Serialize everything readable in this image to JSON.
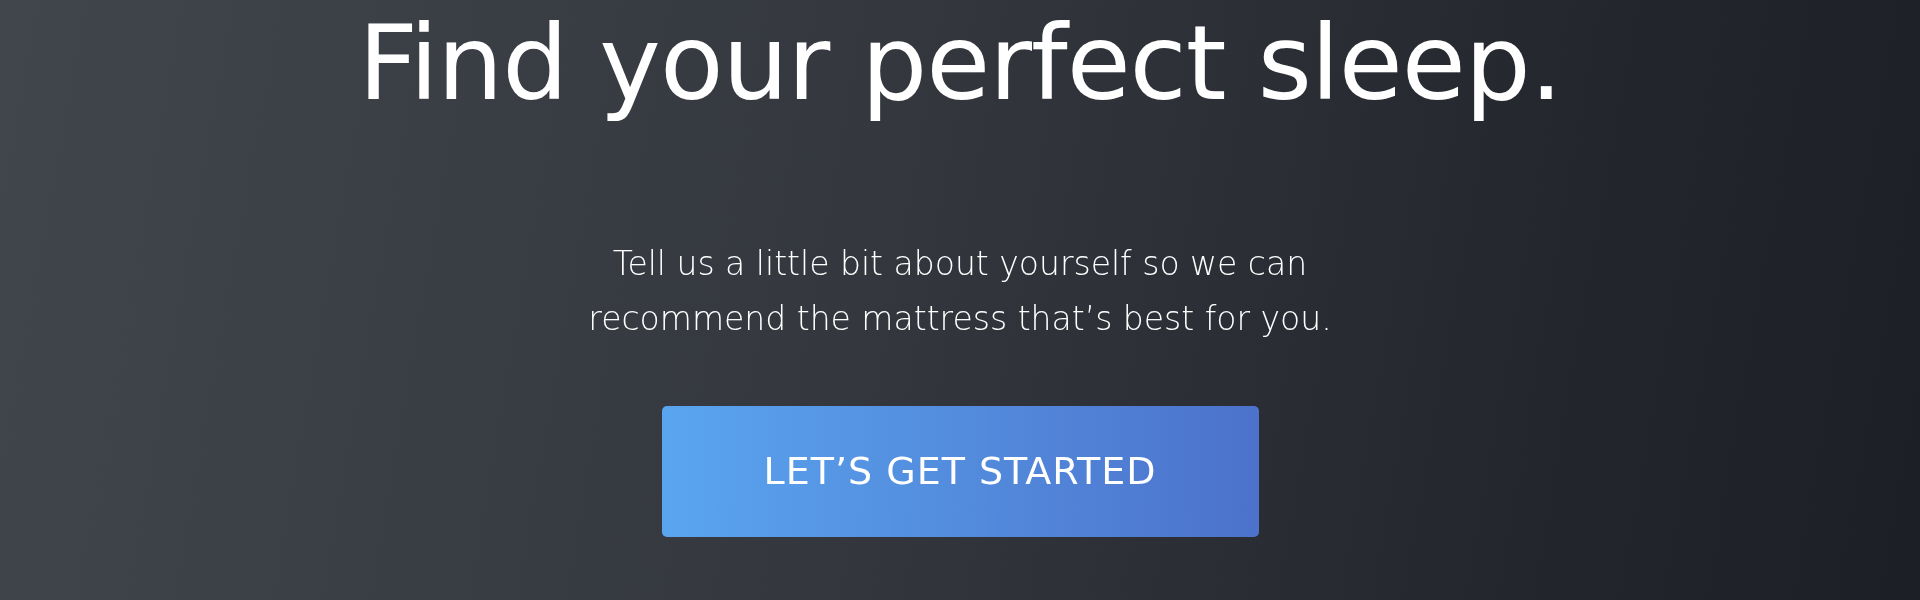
{
  "hero": {
    "title": "Find your perfect sleep.",
    "subtitle_lines": [
      "Tell us a little bit about yourself so we can",
      "recommend the mattress that’s best for you."
    ],
    "button": "LET’S GET STARTED"
  }
}
